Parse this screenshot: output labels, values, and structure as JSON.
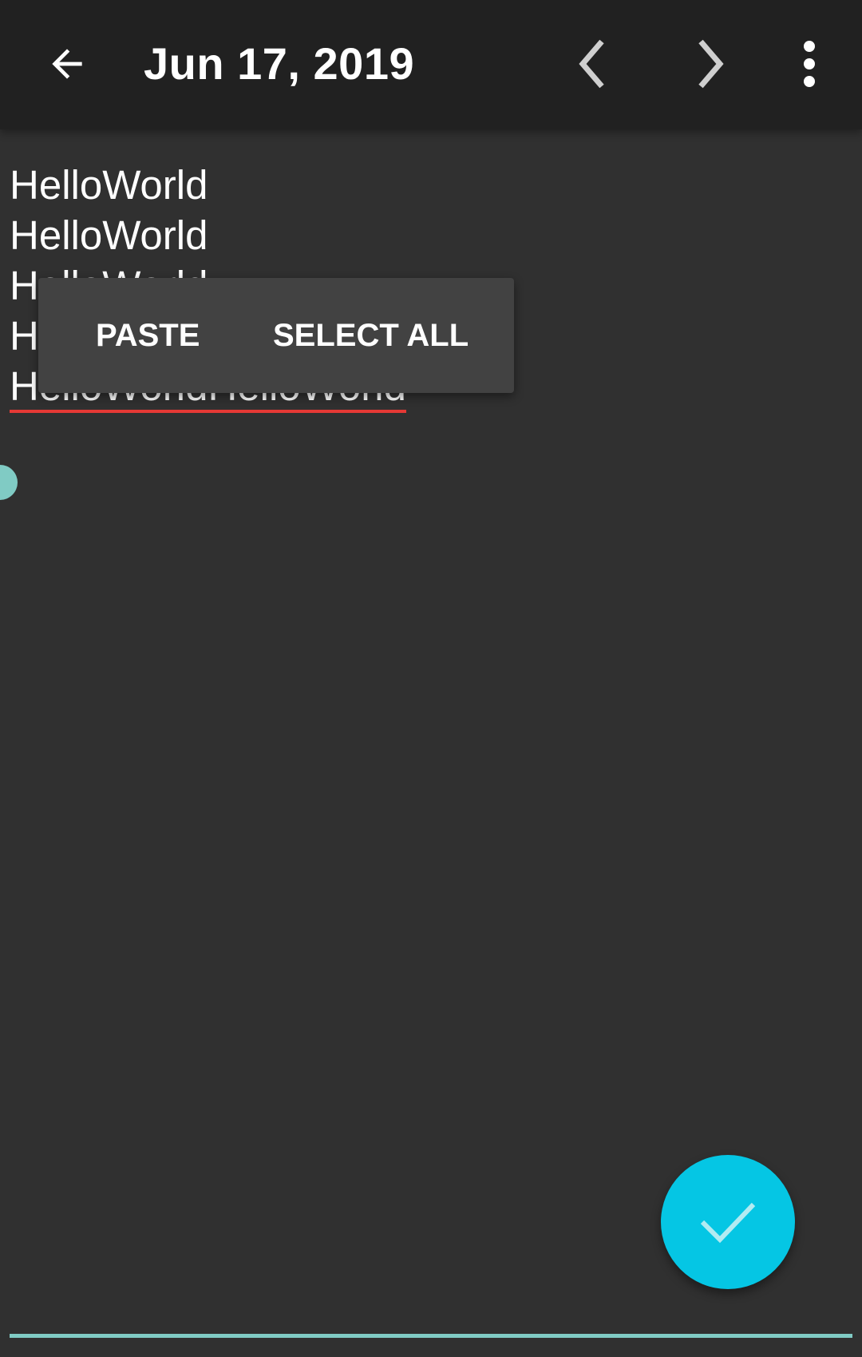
{
  "toolbar": {
    "title": "Jun 17, 2019",
    "back_icon": "arrow-left-icon",
    "prev_icon": "chevron-left-icon",
    "next_icon": "chevron-right-icon",
    "more_icon": "more-vertical-icon"
  },
  "editor": {
    "lines": [
      "HelloWorld",
      "HelloWorld",
      "HelloWorld",
      "HelloWorld",
      "HelloWorldHelloWorld"
    ],
    "spellcheck_underline_color": "#e53935",
    "cursor_handle_color": "#80cbc4"
  },
  "context_menu": {
    "paste_label": "PASTE",
    "select_all_label": "SELECT ALL"
  },
  "fab": {
    "icon": "check-icon",
    "color": "#05c6e4"
  },
  "colors": {
    "toolbar_bg": "#212121",
    "page_bg": "#303030",
    "accent": "#80cbc4"
  }
}
